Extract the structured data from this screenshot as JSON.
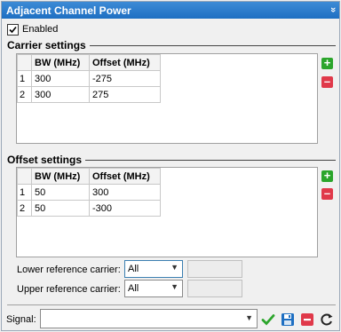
{
  "panel": {
    "title": "Adjacent Channel Power",
    "collapse_glyph": "»",
    "enabled_label": "Enabled",
    "enabled_checked": true
  },
  "carrier": {
    "title": "Carrier settings",
    "headers": [
      "BW (MHz)",
      "Offset (MHz)"
    ],
    "rows": [
      {
        "index": "1",
        "bw": "300",
        "offset": "-275"
      },
      {
        "index": "2",
        "bw": "300",
        "offset": "275"
      }
    ]
  },
  "offset": {
    "title": "Offset settings",
    "headers": [
      "BW (MHz)",
      "Offset (MHz)"
    ],
    "rows": [
      {
        "index": "1",
        "bw": "50",
        "offset": "300"
      },
      {
        "index": "2",
        "bw": "50",
        "offset": "-300"
      }
    ]
  },
  "reference": {
    "lower_label": "Lower reference carrier:",
    "lower_value": "All",
    "upper_label": "Upper reference carrier:",
    "upper_value": "All"
  },
  "signal": {
    "label": "Signal:",
    "value": ""
  },
  "colors": {
    "title_bar": "#2a78cc",
    "add": "#2ba52b",
    "remove": "#e0394a",
    "confirm": "#2ba52b",
    "save": "#1e6fc2"
  }
}
